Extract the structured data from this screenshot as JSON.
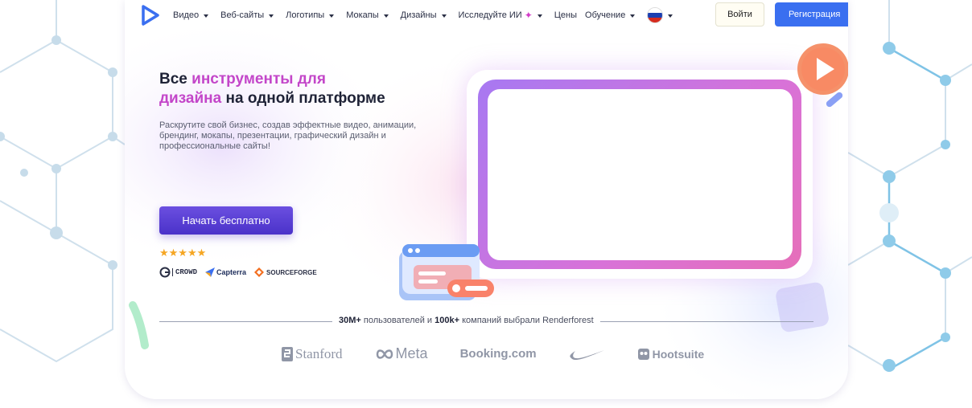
{
  "nav": {
    "items": [
      {
        "label": "Видео",
        "has_caret": true
      },
      {
        "label": "Веб-сайты",
        "has_caret": true
      },
      {
        "label": "Логотипы",
        "has_caret": true
      },
      {
        "label": "Мокапы",
        "has_caret": true
      },
      {
        "label": "Дизайны",
        "has_caret": true
      },
      {
        "label": "Исследуйте ИИ",
        "has_caret": true
      },
      {
        "label": "Цены",
        "has_caret": false
      },
      {
        "label": "Обучение",
        "has_caret": true
      }
    ],
    "login_label": "Войти",
    "register_label": "Регистрация",
    "accent_color": "#3a6ff0"
  },
  "hero": {
    "title_part1": "Все ",
    "title_highlight1": "инструменты для",
    "title_highlight2": "дизайна",
    "title_part2": " на одной платформе",
    "subtitle": "Раскрутите свой бизнес, создав эффектные видео, анимации, брендинг, мокапы, презентации, графический дизайн и профессиональные сайты!",
    "cta_label": "Начать бесплатно",
    "stars": "★★★★★",
    "rating": 5,
    "review_sites": [
      "CROWD",
      "Capterra",
      "SOURCEFORGE"
    ],
    "highlight_color": "#c346c9"
  },
  "stats": {
    "users": "30M+",
    "users_text": " пользователей и ",
    "companies": "100k+",
    "companies_text": " компаний выбрали Renderforest"
  },
  "brands": [
    "Stanford",
    "Meta",
    "Booking.com",
    "Hootsuite"
  ]
}
